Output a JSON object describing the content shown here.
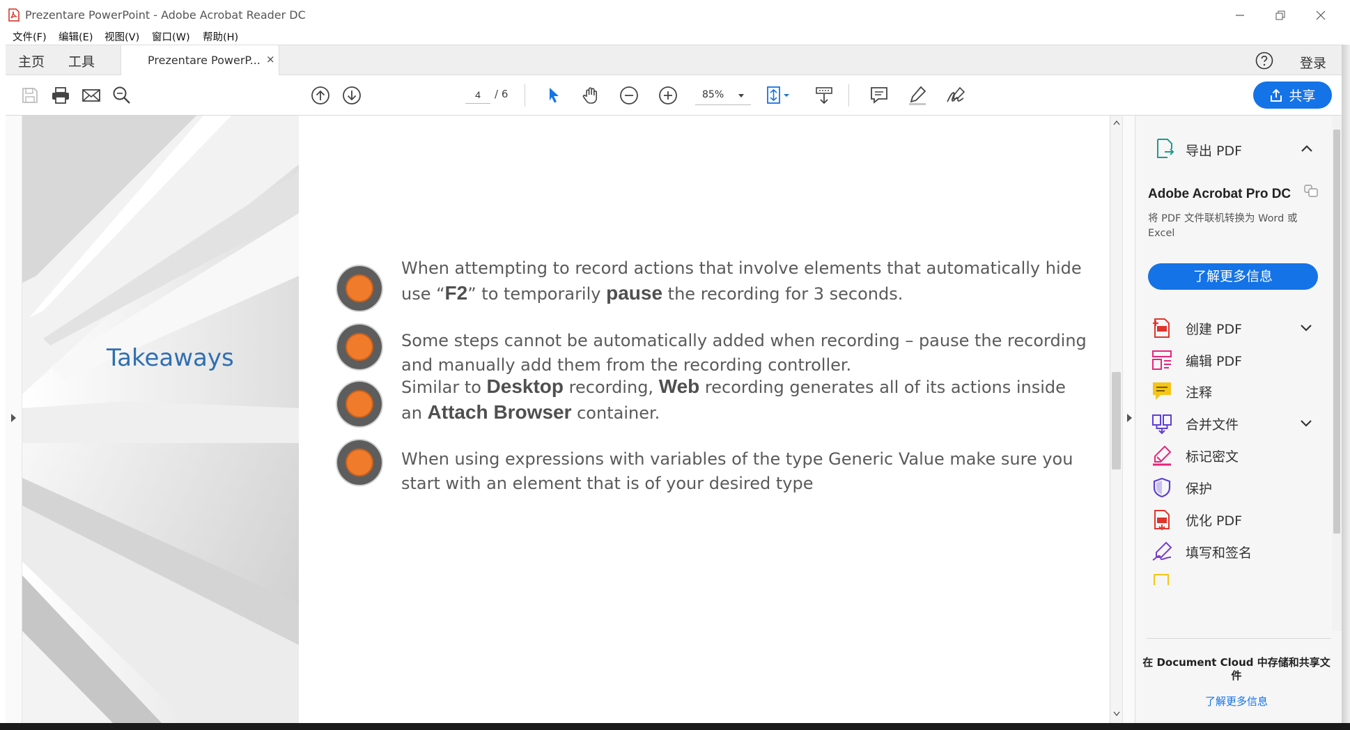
{
  "window": {
    "title": "Prezentare PowerPoint - Adobe Acrobat Reader DC"
  },
  "menu": {
    "items": [
      "文件(F)",
      "编辑(E)",
      "视图(V)",
      "窗口(W)",
      "帮助(H)"
    ]
  },
  "tabs": {
    "home": "主页",
    "tools": "工具",
    "document": "Prezentare PowerP...",
    "close": "×",
    "login": "登录"
  },
  "toolbar": {
    "current_page": "4",
    "page_total": "/ 6",
    "zoom": "85%",
    "share_label": "共享"
  },
  "slide": {
    "title": "Takeaways",
    "bullets": [
      [
        "When attempting to record actions that involve elements that automatically hide use “",
        "F2",
        "” to temporarily ",
        "pause",
        " the recording for 3 seconds."
      ],
      [
        "Some steps cannot be automatically added when recording – pause the recording and manually add them from the recording controller."
      ],
      [
        "Similar to ",
        "Desktop",
        " recording, ",
        "Web",
        " recording generates all of its actions inside an ",
        "Attach Browser",
        " container."
      ],
      [
        "When using expressions with variables of the type Generic Value make sure you start with an element that is of your desired type"
      ]
    ]
  },
  "panel": {
    "export_pdf": "导出 PDF",
    "promo_title": "Adobe Acrobat Pro DC",
    "promo_desc": "将 PDF 文件联机转换为 Word 或 Excel",
    "learn_more": "了解更多信息",
    "tools": [
      {
        "label": "创建 PDF",
        "icon": "create-pdf-icon",
        "chevron": true
      },
      {
        "label": "编辑 PDF",
        "icon": "edit-pdf-icon",
        "chevron": false
      },
      {
        "label": "注释",
        "icon": "comment-icon",
        "chevron": false
      },
      {
        "label": "合并文件",
        "icon": "combine-files-icon",
        "chevron": true
      },
      {
        "label": "标记密文",
        "icon": "redact-icon",
        "chevron": false
      },
      {
        "label": "保护",
        "icon": "protect-icon",
        "chevron": false
      },
      {
        "label": "优化 PDF",
        "icon": "optimize-pdf-icon",
        "chevron": false
      },
      {
        "label": "填写和签名",
        "icon": "fill-sign-icon",
        "chevron": false
      }
    ],
    "cloud_text": "在 Document Cloud 中存储和共享文件",
    "cloud_link": "了解更多信息"
  },
  "colors": {
    "accent": "#1473e6",
    "slide_title": "#2f6fb0",
    "bullet": "#f07b2b"
  }
}
